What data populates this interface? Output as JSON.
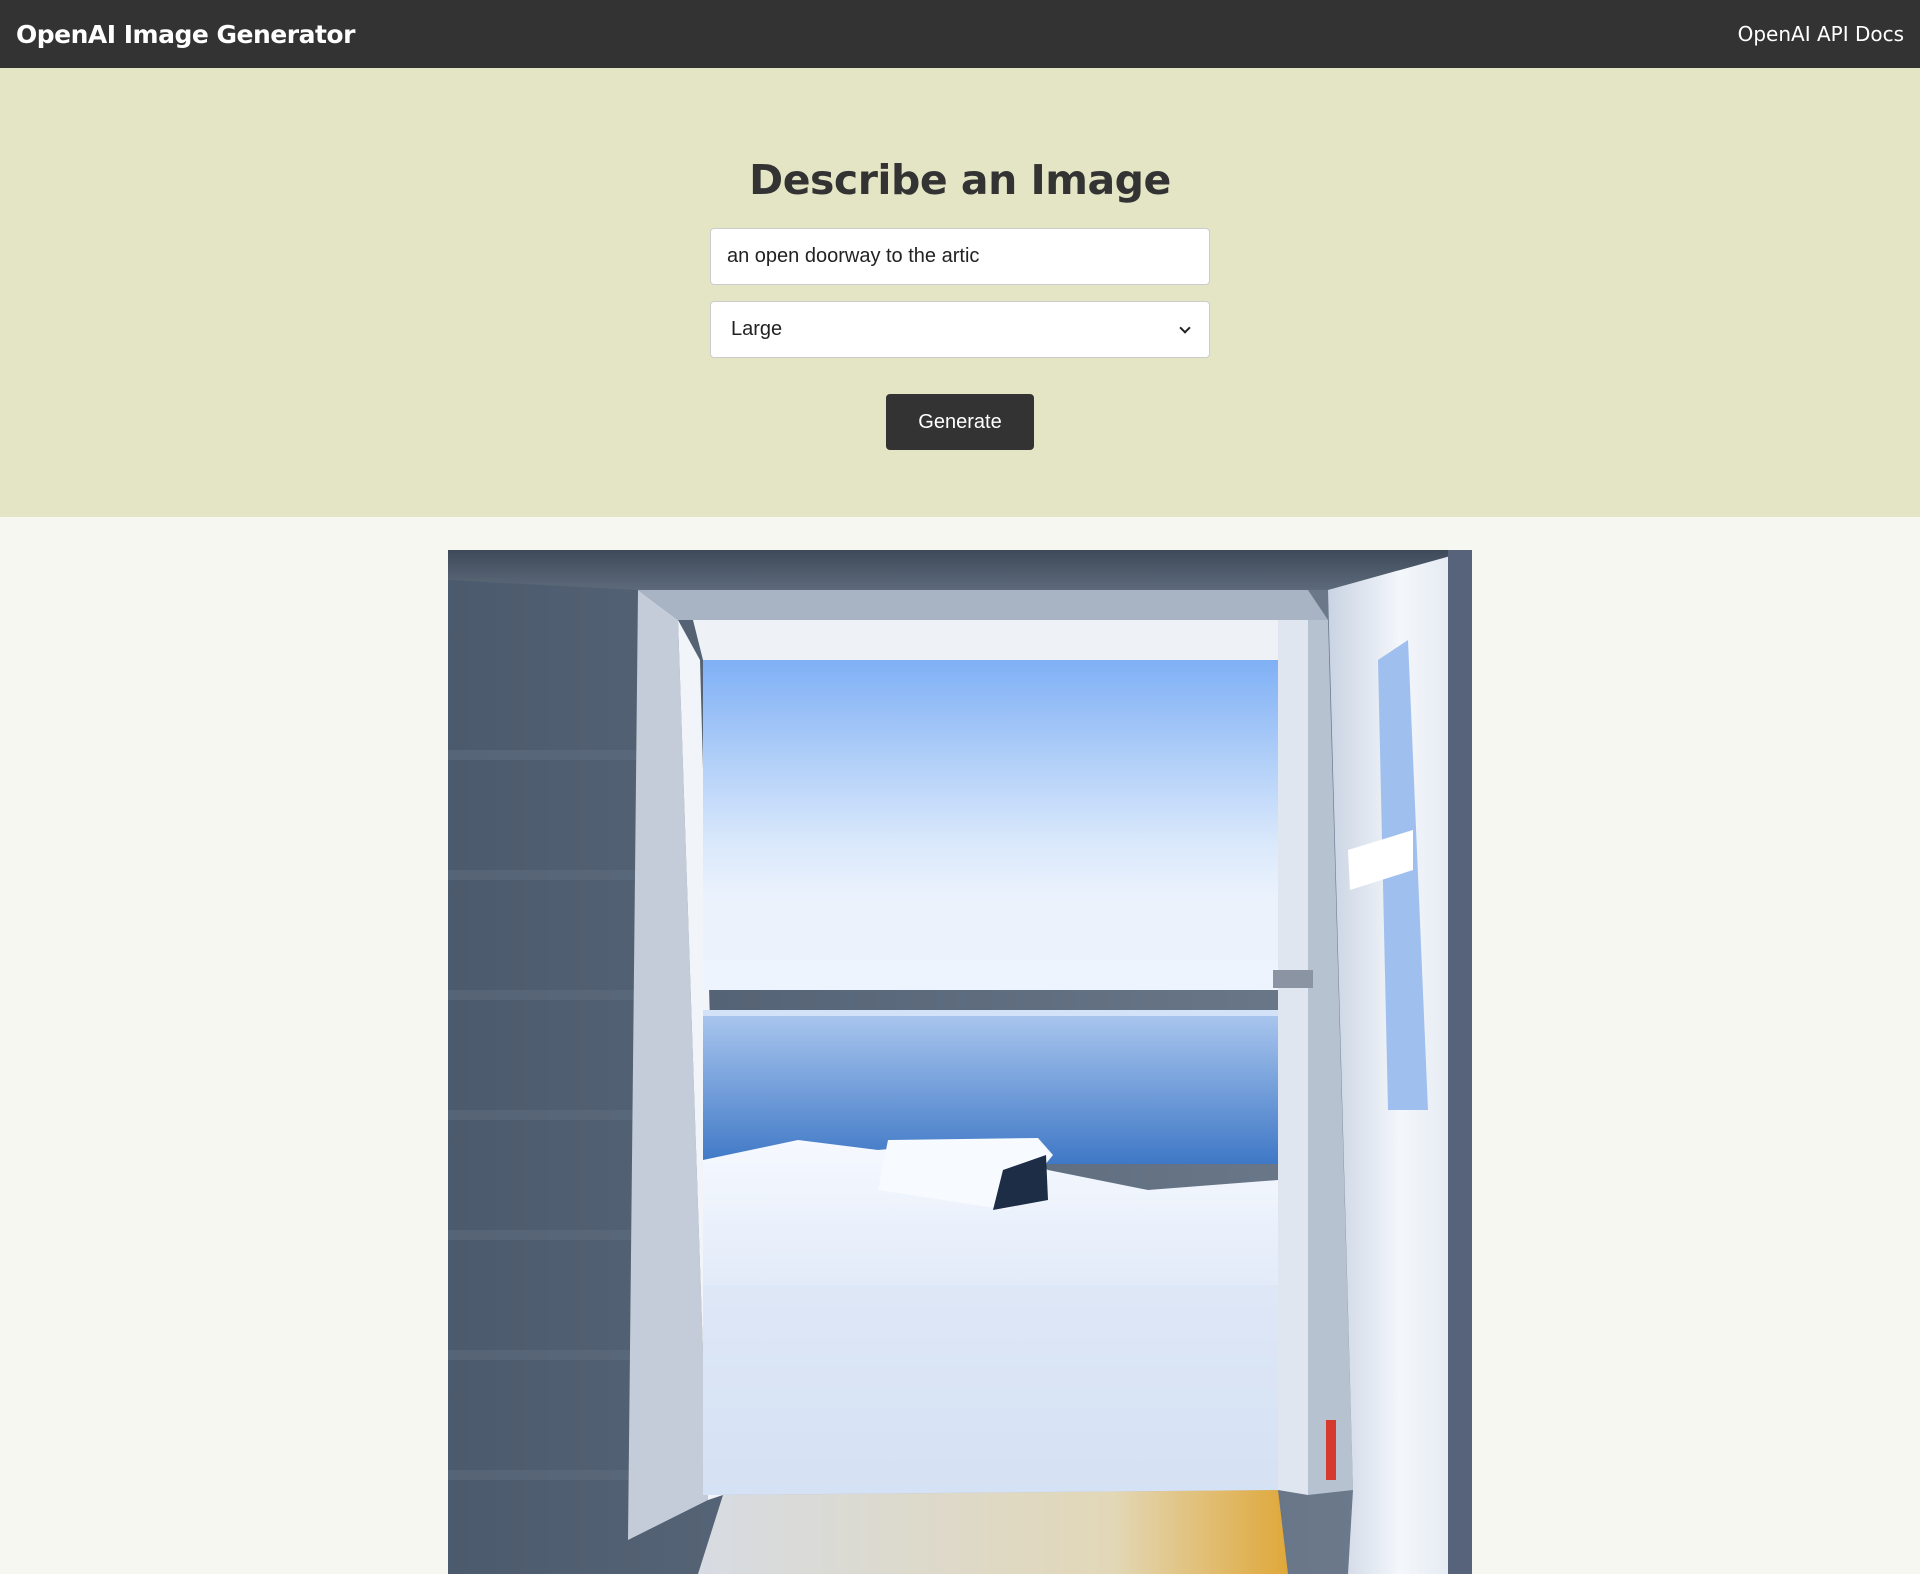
{
  "navbar": {
    "brand": "OpenAI Image Generator",
    "docs_link": "OpenAI API Docs"
  },
  "form": {
    "title": "Describe an Image",
    "prompt_value": "an open doorway to the artic",
    "size_selected": "Large",
    "generate_label": "Generate"
  },
  "result": {
    "alt": "an open doorway to the artic"
  },
  "colors": {
    "navbar": "#333333",
    "hero_bg": "#e4e5c4",
    "page_bg": "#f6f7f1",
    "button": "#333333"
  }
}
